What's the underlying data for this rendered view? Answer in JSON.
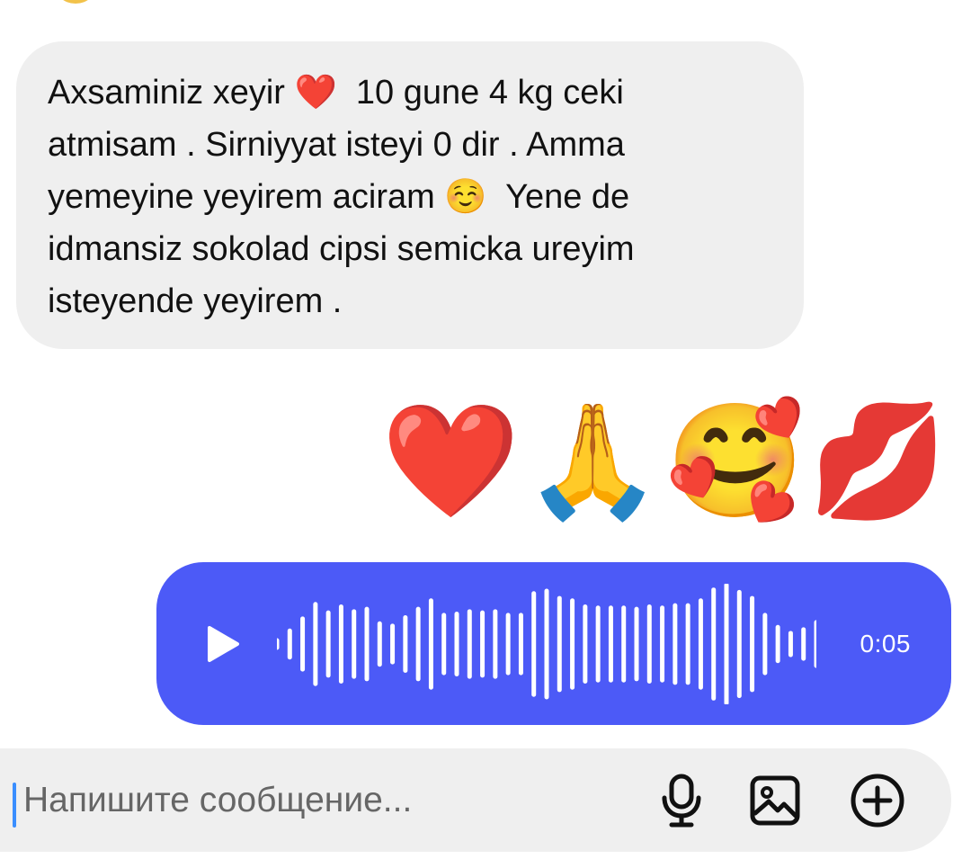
{
  "conversation": {
    "incoming_message": {
      "text": "Axsaminiz xeyir ❤️  10 gune 4 kg ceki\natmisam . Sirniyyat isteyi 0 dir . Amma\nyemeyine yeyirem aciram ☺️  Yene de\nidmansiz sokolad cipsi semicka ureyim\nisteyende yeyirem ."
    },
    "emoji_message": {
      "text": "❤️🙏🥰💋",
      "icons": [
        "red-heart-icon",
        "folded-hands-icon",
        "smiling-face-with-hearts-icon",
        "kiss-mark-icon"
      ]
    },
    "voice_message": {
      "duration": "0:05",
      "play_icon": "play-icon",
      "accent_color": "#4c5af7",
      "waveform_levels": [
        0.04,
        0.22,
        0.42,
        0.66,
        0.52,
        0.62,
        0.54,
        0.58,
        0.34,
        0.3,
        0.44,
        0.58,
        0.72,
        0.48,
        0.5,
        0.54,
        0.52,
        0.54,
        0.48,
        0.48,
        0.84,
        0.88,
        0.76,
        0.72,
        0.62,
        0.6,
        0.6,
        0.6,
        0.58,
        0.62,
        0.6,
        0.64,
        0.64,
        0.72,
        0.9,
        0.98,
        0.86,
        0.76,
        0.48,
        0.28,
        0.18,
        0.24,
        0.36
      ]
    }
  },
  "composer": {
    "placeholder": "Напишите сообщение...",
    "icons": {
      "microphone": "microphone-icon",
      "image": "image-icon",
      "add": "plus-circle-icon"
    }
  }
}
